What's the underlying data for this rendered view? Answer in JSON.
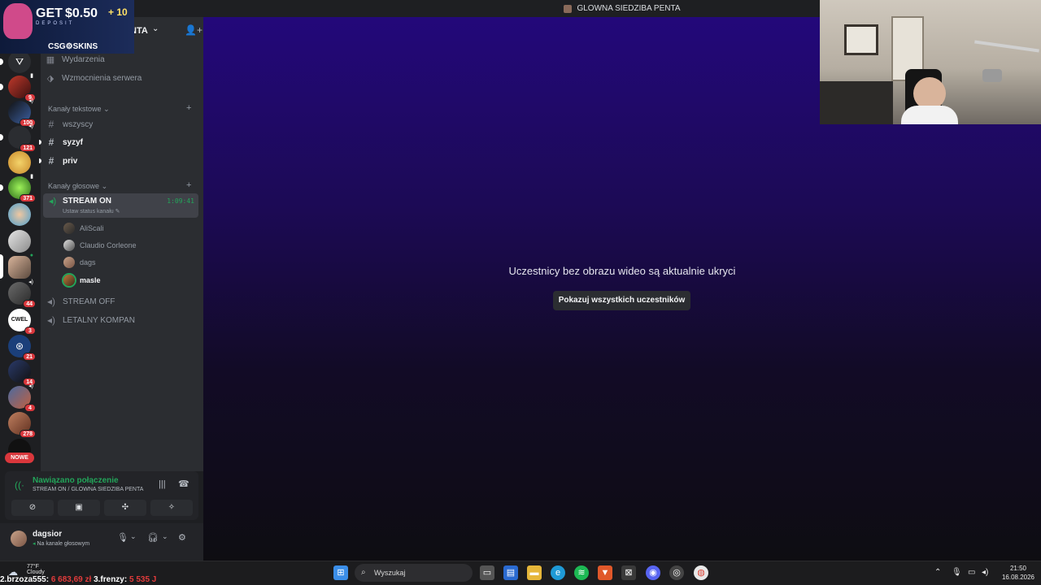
{
  "window": {
    "title": "GLOWNA SIEDZIBA PENTA"
  },
  "server_header": {
    "name": "NTA",
    "chevron": "⌄"
  },
  "promo": {
    "get": "GET",
    "amount": "$0.50",
    "plus": "+ 10",
    "deposit": "DEPOSIT",
    "brand": "CSG⚙SKINS"
  },
  "server_rail": {
    "badges": [
      "9",
      "100",
      "121",
      "371",
      "44",
      "3",
      "21",
      "14",
      "4",
      "278"
    ],
    "nowe_label": "NOWE",
    "server_label_cwel": "CWEL"
  },
  "sidebar": {
    "top_items": [
      {
        "label": "Wydarzenia",
        "icon": "calendar-icon"
      },
      {
        "label": "Wzmocnienia serwera",
        "icon": "boost-icon"
      }
    ],
    "text_category": "Kanały tekstowe",
    "text_channels": [
      {
        "name": "wszyscy",
        "unread": false
      },
      {
        "name": "syzyf",
        "unread": true
      },
      {
        "name": "priv",
        "unread": true
      }
    ],
    "voice_category": "Kanały głosowe",
    "active_voice": {
      "name": "STREAM ON",
      "timer": "1:09:41",
      "status": "Ustaw status kanału"
    },
    "members": [
      {
        "name": "AliScali",
        "speaking": false
      },
      {
        "name": "Claudio Corleone",
        "speaking": false
      },
      {
        "name": "dags",
        "speaking": false
      },
      {
        "name": "masle",
        "speaking": true
      }
    ],
    "other_voice": [
      "STREAM OFF",
      "LETALNY KOMPAN"
    ]
  },
  "voice_panel": {
    "status": "Nawiązano połączenie",
    "location": "STREAM ON / GLOWNA SIEDZIBA PENTA"
  },
  "user_panel": {
    "username": "dagsior",
    "status": "Na kanale głosowym"
  },
  "stage": {
    "message": "Uczestnicy bez obrazu wideo są aktualnie ukryci",
    "show_button": "Pokazuj wszystkich uczestników"
  },
  "taskbar": {
    "weather_temp": "77°F",
    "weather_desc": "Cloudy",
    "search_placeholder": "Wyszukaj",
    "time": "21:50",
    "date": "16.08.2026"
  },
  "ticker": {
    "entries": [
      {
        "rank": "2.brzoza555:",
        "amount": "6 683,69 zł"
      },
      {
        "rank": "3.frenzy:",
        "amount": "5 535 J"
      }
    ]
  },
  "colors": {
    "accent_green": "#23a55a",
    "badge_red": "#da373c",
    "stage_top": "#23087a"
  }
}
